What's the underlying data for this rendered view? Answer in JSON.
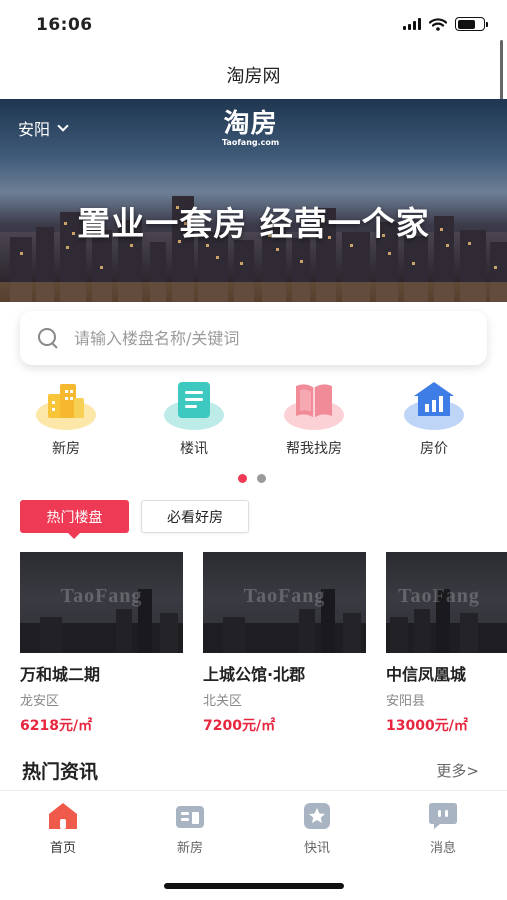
{
  "status": {
    "time": "16:06"
  },
  "header": {
    "title": "淘房网"
  },
  "banner": {
    "city": "安阳",
    "logo_main": "淘房",
    "logo_sub": "Taofang.com",
    "slogan": "置业一套房 经营一个家"
  },
  "search": {
    "placeholder": "请输入楼盘名称/关键词"
  },
  "quick_nav": [
    {
      "label": "新房",
      "icon": "building-icon",
      "color": "#f5b82e"
    },
    {
      "label": "楼讯",
      "icon": "news-icon",
      "color": "#3ec9c0"
    },
    {
      "label": "帮我找房",
      "icon": "book-icon",
      "color": "#f08b97"
    },
    {
      "label": "房价",
      "icon": "price-chart-icon",
      "color": "#3f7de6"
    }
  ],
  "pager": {
    "active_index": 0,
    "active_color": "#ee3a55",
    "inactive_color": "#9a9a9a"
  },
  "hot_tabs": {
    "active": "热门楼盘",
    "inactive": "必看好房"
  },
  "listings": [
    {
      "name": "万和城二期",
      "district": "龙安区",
      "price": "6218元/㎡",
      "watermark": "TaoFang"
    },
    {
      "name": "上城公馆·北郡",
      "district": "北关区",
      "price": "7200元/㎡",
      "watermark": "TaoFang"
    },
    {
      "name": "中信凤凰城",
      "district": "安阳县",
      "price": "13000元/㎡",
      "watermark": "TaoFang"
    }
  ],
  "news": {
    "title": "热门资讯",
    "more": "更多>"
  },
  "tab_bar": [
    {
      "label": "首页",
      "icon": "home-icon",
      "active": true
    },
    {
      "label": "新房",
      "icon": "new-house-icon",
      "active": false
    },
    {
      "label": "快讯",
      "icon": "flash-news-icon",
      "active": false
    },
    {
      "label": "消息",
      "icon": "message-icon",
      "active": false
    }
  ],
  "colors": {
    "accent": "#ee3a55",
    "price": "#e8273f",
    "tab_active": "#f05a4a",
    "tab_inactive": "#a8b4c2"
  }
}
